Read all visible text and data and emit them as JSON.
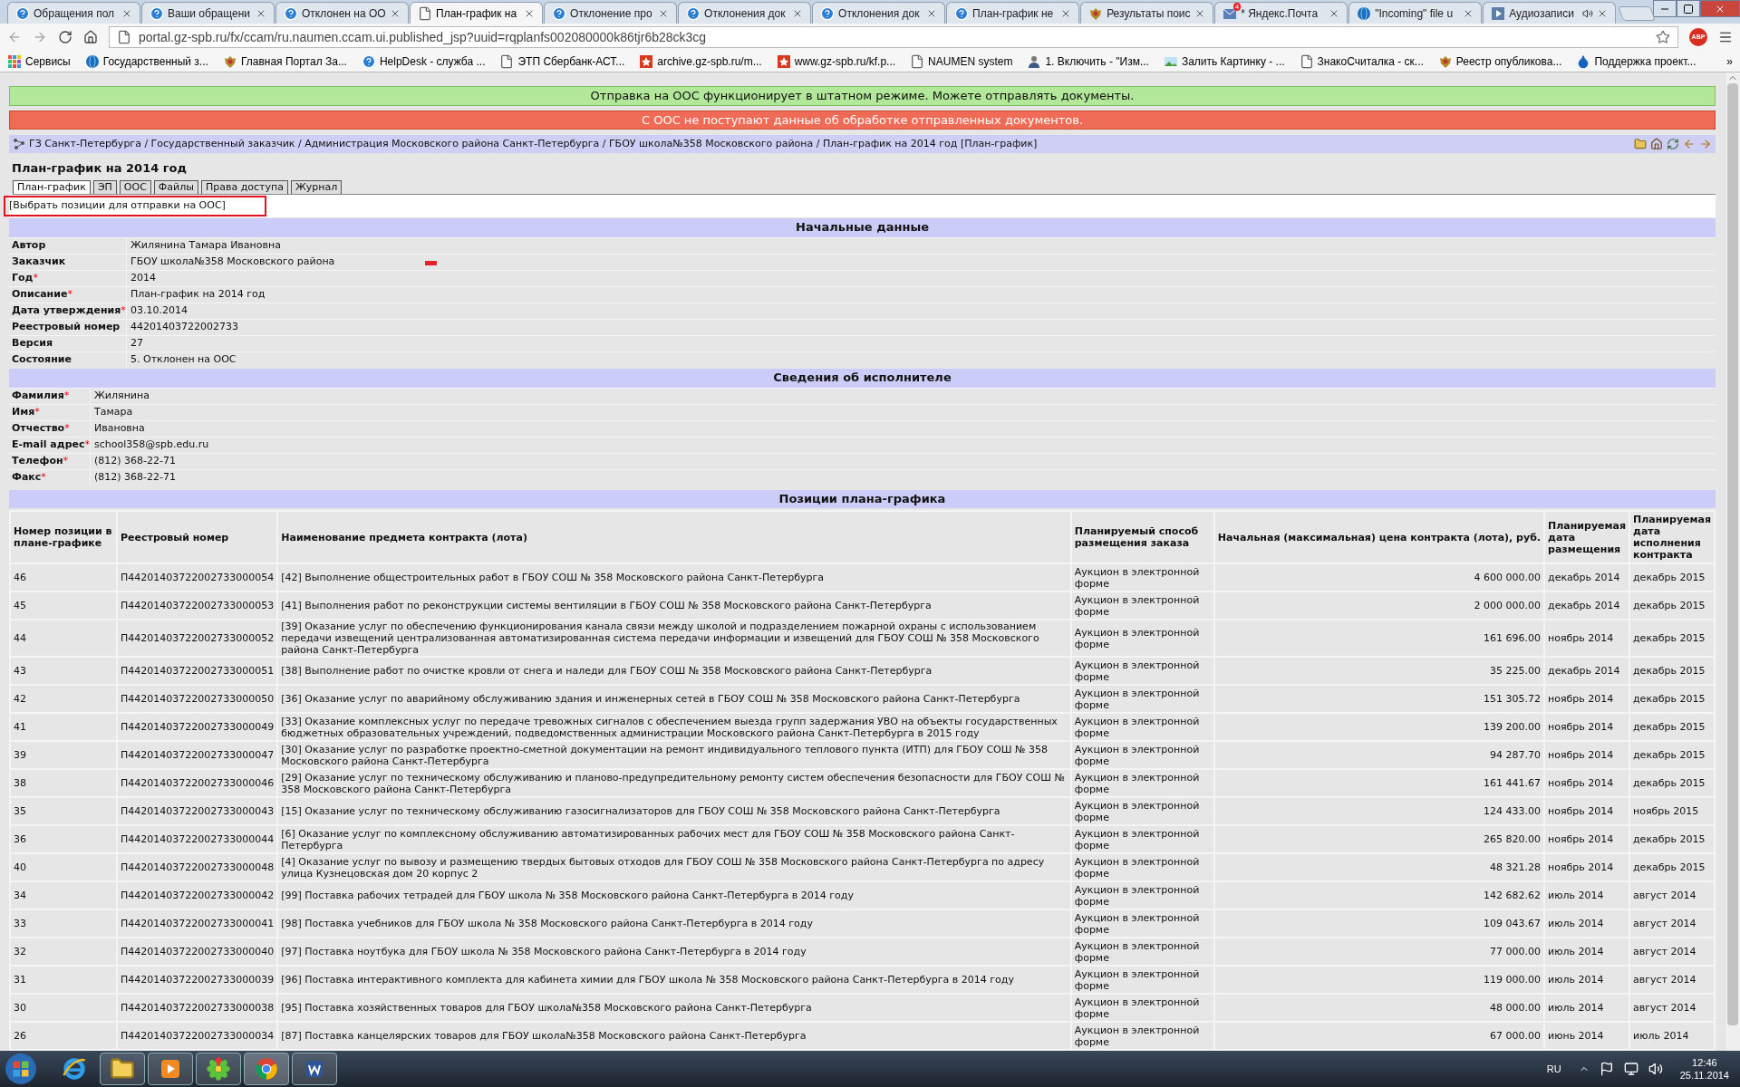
{
  "browser": {
    "tabs": [
      {
        "title": "Обращения пол",
        "kind": "help",
        "selected": false,
        "audio": false
      },
      {
        "title": "Ваши обращени",
        "kind": "help",
        "selected": false,
        "audio": false
      },
      {
        "title": "Отклонен на ОО",
        "kind": "help",
        "selected": false,
        "audio": false
      },
      {
        "title": "План-график на",
        "kind": "page",
        "selected": true,
        "audio": false
      },
      {
        "title": "Отклонение про",
        "kind": "help",
        "selected": false,
        "audio": false
      },
      {
        "title": "Отклонения док",
        "kind": "help",
        "selected": false,
        "audio": false
      },
      {
        "title": "Отклонения док",
        "kind": "help",
        "selected": false,
        "audio": false
      },
      {
        "title": "План-график не",
        "kind": "help",
        "selected": false,
        "audio": false
      },
      {
        "title": "Результаты поис",
        "kind": "emblem",
        "selected": false,
        "audio": false
      },
      {
        "title": "* Яндекс.Почта",
        "kind": "mail",
        "badge": "4",
        "selected": false,
        "audio": false
      },
      {
        "title": "\"Incoming\" file u",
        "kind": "globe",
        "selected": false,
        "audio": false
      },
      {
        "title": "Аудиозаписи",
        "kind": "play",
        "selected": false,
        "audio": true
      }
    ],
    "url": "portal.gz-spb.ru/fx/ccam/ru.naumen.ccam.ui.published_jsp?uuid=rqplanfs002080000k86tjr6b28ck3cg",
    "extension_badge": "ABP",
    "bookmarks": [
      {
        "label": "Сервисы",
        "kind": "apps"
      },
      {
        "label": "Государственный з...",
        "kind": "globe"
      },
      {
        "label": "Главная Портал За...",
        "kind": "emblem"
      },
      {
        "label": "HelpDesk - служба ...",
        "kind": "help"
      },
      {
        "label": "ЭТП Сбербанк-АСТ...",
        "kind": "page"
      },
      {
        "label": "archive.gz-spb.ru/m...",
        "kind": "red"
      },
      {
        "label": "www.gz-spb.ru/kf.p...",
        "kind": "red"
      },
      {
        "label": "NAUMEN system",
        "kind": "page"
      },
      {
        "label": "1. Включить - \"Изм...",
        "kind": "person"
      },
      {
        "label": "Залить Картинку - ...",
        "kind": "image"
      },
      {
        "label": "ЗнакоСчиталка - ск...",
        "kind": "page"
      },
      {
        "label": "Реестр опубликова...",
        "kind": "emblem"
      },
      {
        "label": "Поддержка проект...",
        "kind": "drop"
      }
    ],
    "more_bookmarks": "»"
  },
  "banners": [
    {
      "text": "Отправка на ООС функционирует в штатном режиме. Можете отправлять документы.",
      "kind": "ok"
    },
    {
      "text": "С ООС не поступают данные об обработке отправленных документов.",
      "kind": "error"
    }
  ],
  "breadcrumb": "ГЗ Санкт-Петербурга / Государственный заказчик / Администрация Московского района Санкт-Петербурга / ГБОУ школа№358 Московского района / План-график на 2014 год [План-график]",
  "title": "План-график на 2014 год",
  "tabs": [
    {
      "label": "План-график",
      "selected": true
    },
    {
      "label": "ЭП",
      "selected": false
    },
    {
      "label": "ООС",
      "selected": false
    },
    {
      "label": "Файлы",
      "selected": false
    },
    {
      "label": "Права доступа",
      "selected": false
    },
    {
      "label": "Журнал",
      "selected": false
    }
  ],
  "action_link": "[Выбрать позиции для отправки на ООС]",
  "sections": [
    {
      "title": "Начальные данные",
      "fields": [
        {
          "label": "Автор",
          "value": "Жилянина Тамара Ивановна"
        },
        {
          "label": "Заказчик",
          "value": "ГБОУ школа№358 Московского района"
        },
        {
          "label": "Год",
          "mark": "*",
          "value": "2014"
        },
        {
          "label": "Описание",
          "mark": "*",
          "value": "План-график на 2014 год"
        },
        {
          "label": "Дата утверждения",
          "mark": "*",
          "value": "03.10.2014"
        },
        {
          "label": "Реестровый номер",
          "value": "44201403722002733"
        },
        {
          "label": "Версия",
          "value": "27"
        },
        {
          "label": "Состояние",
          "value": "5. Отклонен на ООС"
        }
      ]
    },
    {
      "title": "Сведения об исполнителе",
      "fields": [
        {
          "label": "Фамилия",
          "mark": "*",
          "value": "Жилянина"
        },
        {
          "label": "Имя",
          "mark": "*",
          "value": "Тамара"
        },
        {
          "label": "Отчество",
          "mark": "*",
          "value": "Ивановна"
        },
        {
          "label": "E-mail адрес",
          "mark": "*",
          "value": "school358@spb.edu.ru"
        },
        {
          "label": "Телефон",
          "mark": "*",
          "value": "(812) 368-22-71"
        },
        {
          "label": "Факс",
          "mark": "*",
          "value": "(812) 368-22-71"
        }
      ]
    }
  ],
  "positions": {
    "title": "Позиции плана-графика",
    "columns": [
      "Номер позиции в плане-графике",
      "Реестровый номер",
      "Наименование предмета контракта (лота)",
      "Планируемый способ размещения заказа",
      "Начальная (максимальная) цена контракта (лота), руб.",
      "Планируемая дата размещения",
      "Планируемая дата исполнения контракта"
    ],
    "rows": [
      [
        "46",
        "П44201403722002733000054",
        "[42] Выполнение общестроительных работ в ГБОУ СОШ № 358 Московского района Санкт-Петербурга",
        "Аукцион в электронной форме",
        "4 600 000.00",
        "декабрь 2014",
        "декабрь 2015"
      ],
      [
        "45",
        "П44201403722002733000053",
        "[41] Выполнения работ по реконструкции системы вентиляции в ГБОУ СОШ № 358 Московского района Санкт-Петербурга",
        "Аукцион в электронной форме",
        "2 000 000.00",
        "декабрь 2014",
        "декабрь 2015"
      ],
      [
        "44",
        "П44201403722002733000052",
        "[39] Оказание услуг по обеспечению функционирования канала связи между школой и подразделением пожарной охраны с использованием передачи извещений централизованная автоматизированная система передачи информации и извещений для ГБОУ СОШ № 358 Московского района Санкт-Петербурга",
        "Аукцион в электронной форме",
        "161 696.00",
        "ноябрь 2014",
        "декабрь 2015"
      ],
      [
        "43",
        "П44201403722002733000051",
        "[38] Выполнение работ по очистке кровли от снега и наледи для ГБОУ СОШ № 358 Московского района Санкт-Петербурга",
        "Аукцион в электронной форме",
        "35 225.00",
        "декабрь 2014",
        "декабрь 2015"
      ],
      [
        "42",
        "П44201403722002733000050",
        "[36] Оказание услуг по аварийному обслуживанию здания и инженерных сетей в ГБОУ СОШ № 358 Московского района Санкт-Петербурга",
        "Аукцион в электронной форме",
        "151 305.72",
        "ноябрь 2014",
        "декабрь 2015"
      ],
      [
        "41",
        "П44201403722002733000049",
        "[33] Оказание комплексных услуг по передаче тревожных сигналов с обеспечением выезда групп задержания УВО на объекты государственных бюджетных образовательных учреждений, подведомственных администрации Московского района Санкт-Петербурга в 2015 году",
        "Аукцион в электронной форме",
        "139 200.00",
        "ноябрь 2014",
        "декабрь 2015"
      ],
      [
        "39",
        "П44201403722002733000047",
        "[30] Оказание услуг по разработке проектно-сметной документации на ремонт индивидуального теплового пункта (ИТП) для ГБОУ СОШ № 358 Московского района Санкт-Петербурга",
        "Аукцион в электронной форме",
        "94 287.70",
        "ноябрь 2014",
        "декабрь 2015"
      ],
      [
        "38",
        "П44201403722002733000046",
        "[29] Оказание услуг по техническому обслуживанию и планово-предупредительному ремонту систем обеспечения безопасности для ГБОУ СОШ № 358 Московского района Санкт-Петербурга",
        "Аукцион в электронной форме",
        "161 441.67",
        "ноябрь 2014",
        "декабрь 2015"
      ],
      [
        "35",
        "П44201403722002733000043",
        "[15] Оказание услуг по техническому обслуживанию газосигнализаторов для ГБОУ СОШ № 358 Московского района Санкт-Петербурга",
        "Аукцион в электронной форме",
        "124 433.00",
        "ноябрь 2014",
        "ноябрь 2015"
      ],
      [
        "36",
        "П44201403722002733000044",
        "[6] Оказание услуг по комплексному обслуживанию автоматизированных рабочих мест для ГБОУ СОШ № 358 Московского района Санкт-Петербурга",
        "Аукцион в электронной форме",
        "265 820.00",
        "ноябрь 2014",
        "декабрь 2015"
      ],
      [
        "40",
        "П44201403722002733000048",
        "[4] Оказание услуг по вывозу и размещению твердых бытовых отходов для ГБОУ СОШ № 358 Московского района Санкт-Петербурга по адресу улица Кузнецовская дом 20 корпус 2",
        "Аукцион в электронной форме",
        "48 321.28",
        "ноябрь 2014",
        "декабрь 2015"
      ],
      [
        "34",
        "П44201403722002733000042",
        "[99] Поставка рабочих тетрадей для ГБОУ школа № 358 Московского района Санкт-Петербурга в 2014 году",
        "Аукцион в электронной форме",
        "142 682.62",
        "июль 2014",
        "август 2014"
      ],
      [
        "33",
        "П44201403722002733000041",
        "[98] Поставка учебников для ГБОУ школа № 358 Московского района Санкт-Петербурга в 2014 году",
        "Аукцион в электронной форме",
        "109 043.67",
        "июль 2014",
        "август 2014"
      ],
      [
        "32",
        "П44201403722002733000040",
        "[97] Поставка ноутбука для ГБОУ школа № 358 Московского района Санкт-Петербурга в 2014 году",
        "Аукцион в электронной форме",
        "77 000.00",
        "июль 2014",
        "август 2014"
      ],
      [
        "31",
        "П44201403722002733000039",
        "[96] Поставка интерактивного комплекта для кабинета химии для ГБОУ школа № 358 Московского района Санкт-Петербурга в 2014 году",
        "Аукцион в электронной форме",
        "119 000.00",
        "июль 2014",
        "август 2014"
      ],
      [
        "30",
        "П44201403722002733000038",
        "[95] Поставка хозяйственных товаров для ГБОУ школа№358 Московского района Санкт-Петербурга",
        "Аукцион в электронной форме",
        "48 000.00",
        "июль 2014",
        "август 2014"
      ],
      [
        "26",
        "П44201403722002733000034",
        "[87] Поставка канцелярских товаров для ГБОУ школа№358 Московского района Санкт-Петербурга",
        "Аукцион в электронной форме",
        "67 000.00",
        "июнь 2014",
        "июль 2014"
      ]
    ]
  },
  "taskbar": {
    "language": "RU",
    "time": "12:46",
    "date": "25.11.2014"
  }
}
